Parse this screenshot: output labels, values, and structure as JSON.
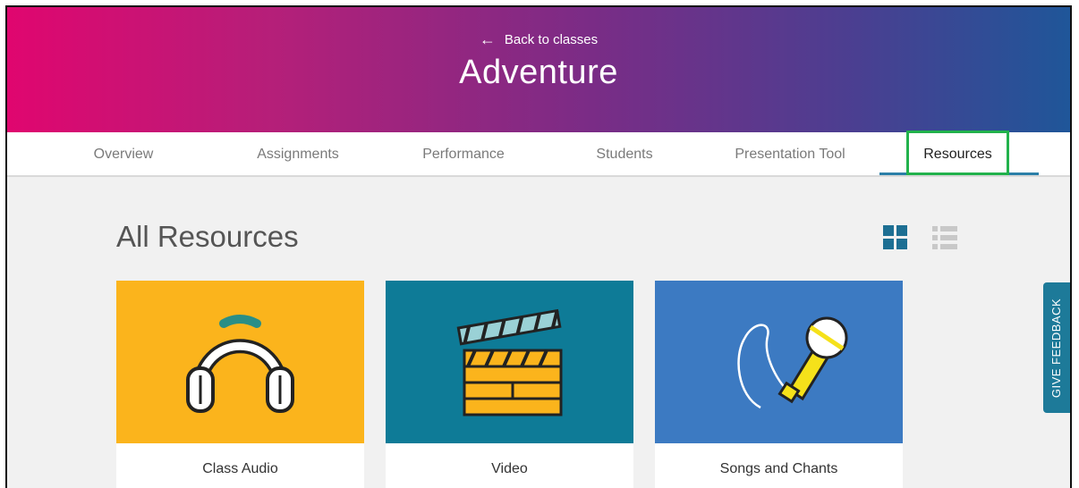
{
  "header": {
    "back_label": "Back to classes",
    "title": "Adventure",
    "gradient_colors": [
      "#e0066f",
      "#7a2c86",
      "#1f5699"
    ]
  },
  "tabs": [
    {
      "label": "Overview",
      "active": false
    },
    {
      "label": "Assignments",
      "active": false
    },
    {
      "label": "Performance",
      "active": false
    },
    {
      "label": "Students",
      "active": false
    },
    {
      "label": "Presentation Tool",
      "active": false
    },
    {
      "label": "Resources",
      "active": true
    }
  ],
  "main": {
    "section_title": "All Resources",
    "view_modes": {
      "selected": "grid-view-icon",
      "other": "list-view-icon"
    },
    "cards": [
      {
        "label": "Class Audio",
        "icon": "headphones-icon",
        "color": "#fbb41c"
      },
      {
        "label": "Video",
        "icon": "clapperboard-icon",
        "color": "#0e7b97"
      },
      {
        "label": "Songs and Chants",
        "icon": "microphone-icon",
        "color": "#3c7ac2"
      }
    ]
  },
  "feedback": {
    "label": "GIVE FEEDBACK",
    "color": "#1d7a99"
  },
  "accents": {
    "tab_underline": "#2b7fa8",
    "highlight_box": "#22b24c"
  }
}
